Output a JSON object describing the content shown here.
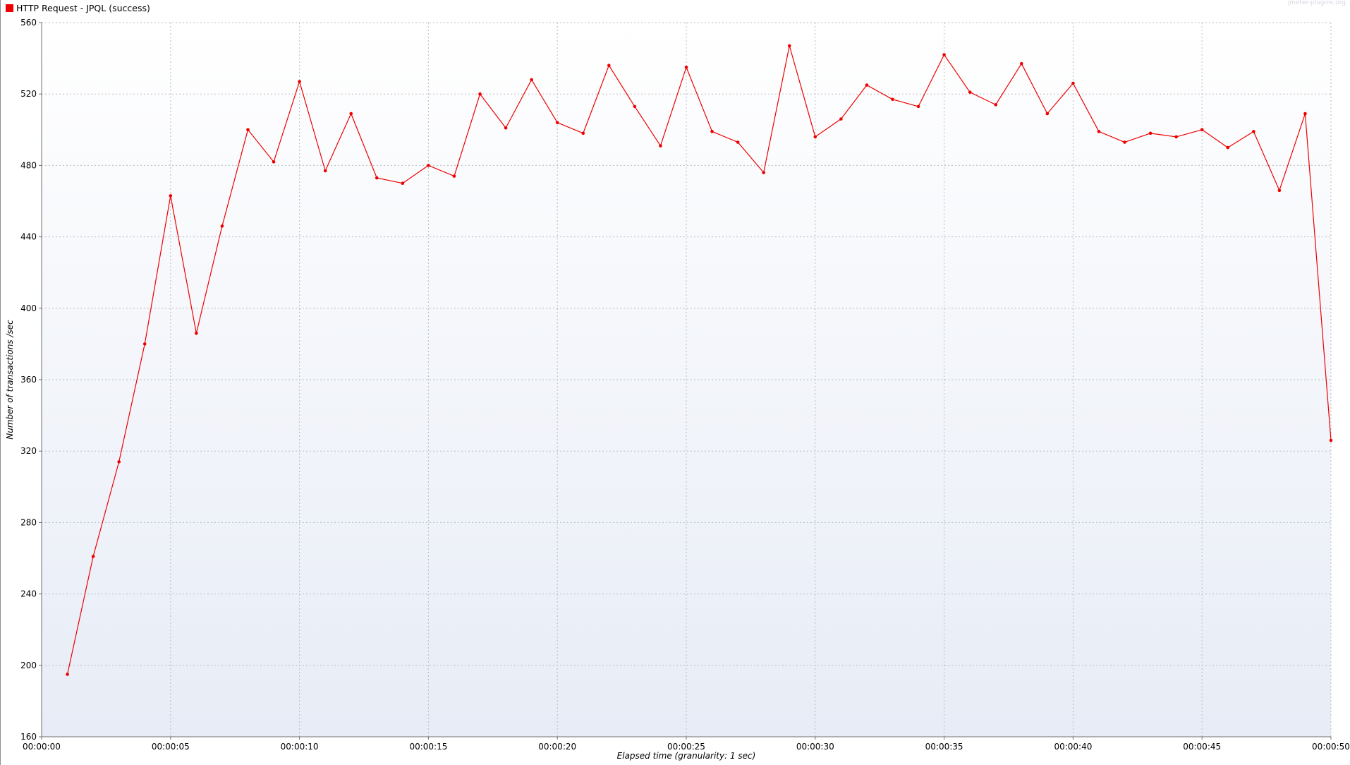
{
  "legend": {
    "label": "HTTP Request - JPQL (success)",
    "color": "#ee0000"
  },
  "watermark": "jmeter-plugins.org",
  "chart_data": {
    "type": "line",
    "title": "",
    "xlabel": "Elapsed time (granularity: 1 sec)",
    "ylabel": "Number of transactions /sec",
    "xlim": [
      0,
      50
    ],
    "ylim": [
      160,
      560
    ],
    "yticks": [
      160,
      200,
      240,
      280,
      320,
      360,
      400,
      440,
      480,
      520,
      560
    ],
    "xticks": [
      {
        "value": 0,
        "label": "00:00:00"
      },
      {
        "value": 5,
        "label": "00:00:05"
      },
      {
        "value": 10,
        "label": "00:00:10"
      },
      {
        "value": 15,
        "label": "00:00:15"
      },
      {
        "value": 20,
        "label": "00:00:20"
      },
      {
        "value": 25,
        "label": "00:00:25"
      },
      {
        "value": 30,
        "label": "00:00:30"
      },
      {
        "value": 35,
        "label": "00:00:35"
      },
      {
        "value": 40,
        "label": "00:00:40"
      },
      {
        "value": 45,
        "label": "00:00:45"
      },
      {
        "value": 50,
        "label": "00:00:50"
      }
    ],
    "grid": true,
    "legend_position": "top-left",
    "series": [
      {
        "name": "HTTP Request - JPQL (success)",
        "color": "#ee0000",
        "x": [
          1,
          2,
          3,
          4,
          5,
          6,
          7,
          8,
          9,
          10,
          11,
          12,
          13,
          14,
          15,
          16,
          17,
          18,
          19,
          20,
          21,
          22,
          23,
          24,
          25,
          26,
          27,
          28,
          29,
          30,
          31,
          32,
          33,
          34,
          35,
          36,
          37,
          38,
          39,
          40,
          41,
          42,
          43,
          44,
          45,
          46,
          47,
          48,
          49,
          50
        ],
        "y": [
          195,
          261,
          314,
          380,
          463,
          386,
          446,
          500,
          482,
          527,
          477,
          509,
          473,
          470,
          480,
          474,
          520,
          501,
          528,
          504,
          498,
          536,
          513,
          491,
          535,
          499,
          493,
          476,
          547,
          496,
          506,
          525,
          517,
          513,
          542,
          521,
          514,
          537,
          509,
          526,
          499,
          493,
          498,
          496,
          500,
          490,
          499,
          466,
          509,
          326
        ]
      }
    ]
  }
}
